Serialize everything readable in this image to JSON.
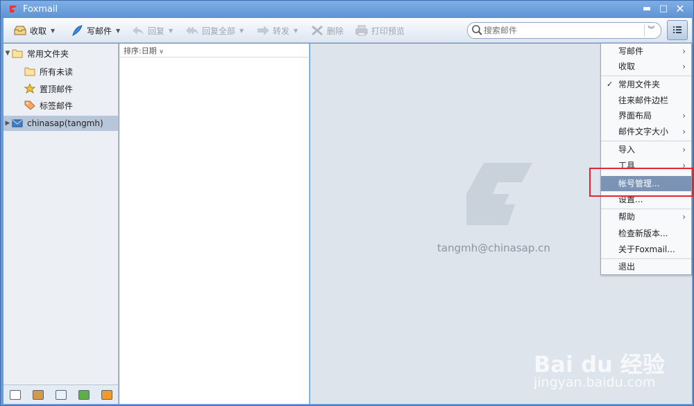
{
  "window": {
    "title": "Foxmail",
    "minimize": "▬",
    "maximize": "□",
    "close": "✕"
  },
  "toolbar": {
    "receive": "收取",
    "compose": "写邮件",
    "reply": "回复",
    "reply_all": "回复全部",
    "forward": "转发",
    "delete": "删除",
    "print_preview": "打印预览",
    "search_placeholder": "搜索邮件"
  },
  "sidebar": {
    "folders": [
      {
        "label": "常用文件夹"
      },
      {
        "label": "所有未读"
      },
      {
        "label": "置顶邮件"
      },
      {
        "label": "标签邮件"
      },
      {
        "label": "chinasap(tangmh)"
      }
    ]
  },
  "maillist": {
    "sort_label": "排序:日期"
  },
  "reading": {
    "account_email": "tangmh@chinasap.cn"
  },
  "menu": {
    "items": [
      {
        "label": "写邮件"
      },
      {
        "label": "收取"
      },
      {
        "label": "常用文件夹",
        "checked": true
      },
      {
        "label": "往来邮件边栏"
      },
      {
        "label": "界面布局"
      },
      {
        "label": "邮件文字大小"
      },
      {
        "label": "导入"
      },
      {
        "label": "工具"
      },
      {
        "label": "帐号管理..."
      },
      {
        "label": "设置..."
      },
      {
        "label": "帮助"
      },
      {
        "label": "检查新版本..."
      },
      {
        "label": "关于Foxmail..."
      },
      {
        "label": "退出"
      }
    ]
  },
  "watermark": {
    "brand": "Bai du 经验",
    "url": "jingyan.baidu.com"
  },
  "colors": {
    "highlight": "#7b94b6",
    "annotation": "#e3262b",
    "accent": "#5e93d4"
  }
}
